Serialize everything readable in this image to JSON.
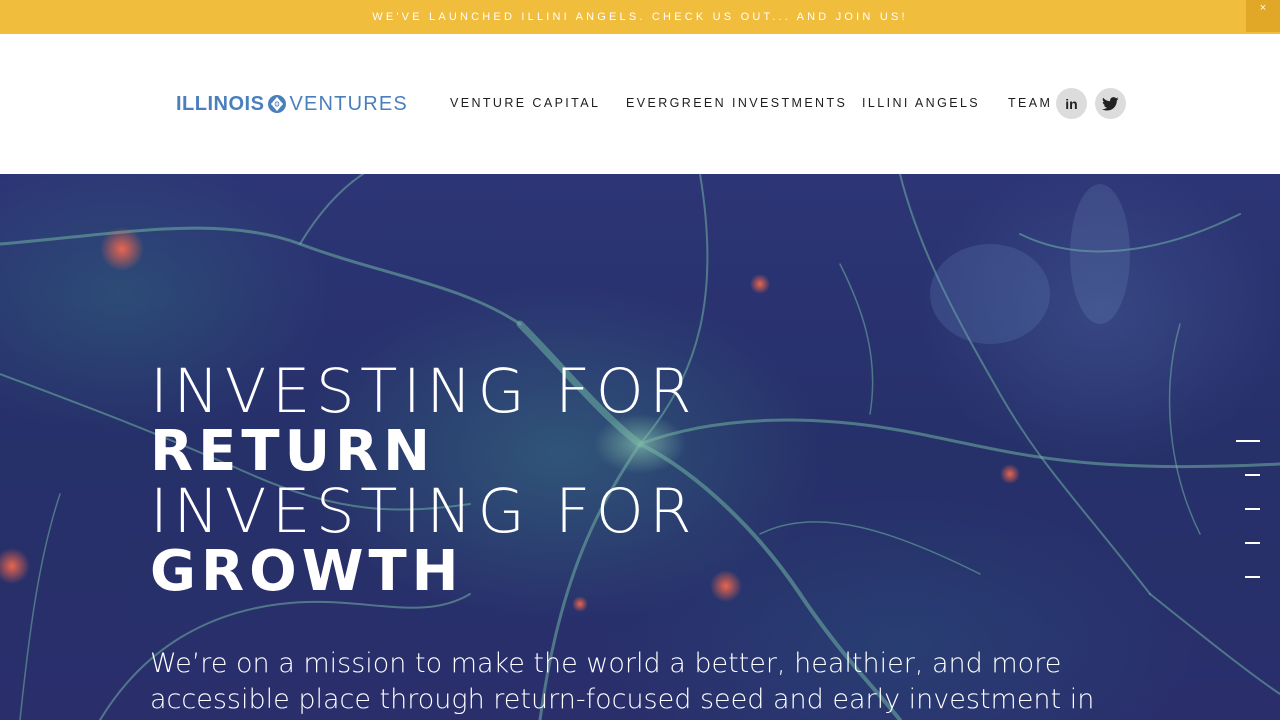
{
  "announcement": {
    "text": "WE'VE LAUNCHED ILLINI ANGELS. CHECK US OUT... AND JOIN US!",
    "close": "×"
  },
  "logo": {
    "part1": "ILLINOIS",
    "part2": "VENTURES"
  },
  "nav": [
    {
      "label": "VENTURE CAPITAL"
    },
    {
      "label": "EVERGREEN INVESTMENTS"
    },
    {
      "label": "ILLINI ANGELS"
    },
    {
      "label": "TEAM"
    }
  ],
  "social": [
    {
      "icon": "linkedin-icon",
      "glyph": "in"
    },
    {
      "icon": "twitter-icon"
    }
  ],
  "hero": {
    "line1": "INVESTING FOR",
    "line2": "RETURN",
    "line3": "INVESTING FOR",
    "line4": "GROWTH",
    "text": "We’re on a mission to make the world a better, healthier, and more accessible place through return-focused seed and early investment in healthcare and technology. Our",
    "slides": {
      "count": 5,
      "active": 1
    }
  },
  "colors": {
    "announcement_bg": "#f0bd3c",
    "brand_blue": "#4a7fbe",
    "hero_bg": "#2a3170"
  }
}
